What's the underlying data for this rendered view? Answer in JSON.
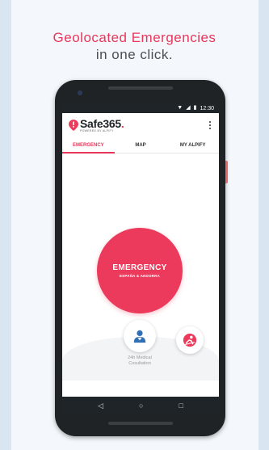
{
  "headline": {
    "line1": "Geolocated Emergencies",
    "line2": "in one click."
  },
  "status_bar": {
    "time": "12:30",
    "icons": [
      "wifi-icon",
      "signal-icon",
      "battery-icon"
    ]
  },
  "app": {
    "brand": "Safe365",
    "brand_suffix": ".",
    "powered_by": "POWERED BY ALPIFY"
  },
  "tabs": [
    {
      "label": "EMERGENCY",
      "active": true
    },
    {
      "label": "MAP",
      "active": false
    },
    {
      "label": "MY ALPIFY",
      "active": false
    }
  ],
  "emergency_button": {
    "title": "EMERGENCY",
    "subtitle": "ESPAÑA & ANDORRA"
  },
  "medical": {
    "label_line1": "24h Medical",
    "label_line2": "Cosultation"
  },
  "colors": {
    "accent": "#ec3a5c",
    "headline_accent": "#e8365a",
    "medical_icon": "#2f6fb5",
    "dark": "#1e2428"
  }
}
